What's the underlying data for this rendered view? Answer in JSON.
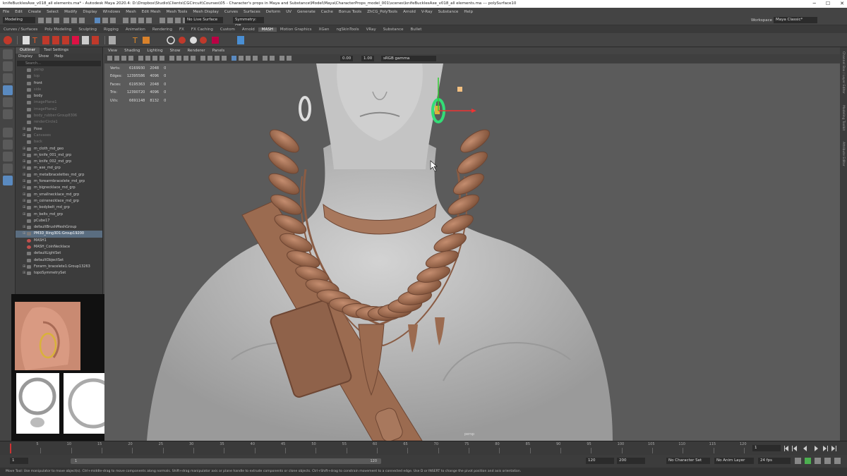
{
  "title_bar": {
    "text": "knifeBucklesAxe_v018_all elements.ma* - Autodesk Maya 2020.4: D:\\Dropbox\\Studio\\Clients\\CGCircuit\\Courses\\05 - Character's props in Maya and Substance\\Model\\Maya\\CharacterProps_model_001\\scenes\\knifeBucklesAxe_v018_all elements.ma  ---  polySurface10",
    "minimize": "─",
    "maximize": "☐",
    "close": "✕"
  },
  "menu_bar": [
    "File",
    "Edit",
    "Create",
    "Select",
    "Modify",
    "Display",
    "Windows",
    "Mesh",
    "Edit Mesh",
    "Mesh Tools",
    "Mesh Display",
    "Curves",
    "Surfaces",
    "Deform",
    "UV",
    "Generate",
    "Cache",
    "Bonus Tools",
    "ZhCG_PolyTools",
    "Arnold",
    "V-Ray",
    "Substance",
    "Help"
  ],
  "status_line": {
    "menu_set": "Modeling",
    "live_surface": "No Live Surface",
    "symmetry": "Symmetry: Off",
    "workspace_label": "Workspace :",
    "workspace_value": "Maya Classic*"
  },
  "shelf_tabs": [
    "Curves / Surfaces",
    "Poly Modeling",
    "Sculpting",
    "Rigging",
    "Animation",
    "Rendering",
    "FX",
    "FX Caching",
    "Custom",
    "Arnold",
    "MASH",
    "Motion Graphics",
    "XGen",
    "ngSkinTools",
    "VRay",
    "Substance",
    "Bullet"
  ],
  "shelf_active": "MASH",
  "outliner": {
    "tabs": [
      "Outliner",
      "Tool Settings"
    ],
    "menus": [
      "Display",
      "Show",
      "Help"
    ],
    "search_placeholder": "Search...",
    "items": [
      {
        "label": "persp",
        "dim": true,
        "exp": ""
      },
      {
        "label": "top",
        "dim": true,
        "exp": ""
      },
      {
        "label": "front",
        "dim": false,
        "exp": ""
      },
      {
        "label": "side",
        "dim": true,
        "exp": ""
      },
      {
        "label": "body",
        "dim": false,
        "exp": ""
      },
      {
        "label": "imagePlane1",
        "dim": true,
        "exp": ""
      },
      {
        "label": "imagePlane2",
        "dim": true,
        "exp": ""
      },
      {
        "label": "body_rubber:Group8306",
        "dim": true,
        "exp": ""
      },
      {
        "label": "renderCircle1",
        "dim": true,
        "exp": ""
      },
      {
        "label": "Pose",
        "dim": false,
        "exp": "⊞"
      },
      {
        "label": "Canvases",
        "dim": true,
        "exp": "⊞"
      },
      {
        "label": "back",
        "dim": true,
        "exp": ""
      },
      {
        "label": "m_cloth_md_geo",
        "dim": false,
        "exp": "⊞"
      },
      {
        "label": "m_knife_001_md_grp",
        "dim": false,
        "exp": "⊞"
      },
      {
        "label": "m_knife_002_md_grp",
        "dim": false,
        "exp": "⊞"
      },
      {
        "label": "m_axe_md_grp",
        "dim": false,
        "exp": "⊞"
      },
      {
        "label": "m_metalbracelettes_md_grp",
        "dim": false,
        "exp": "⊞"
      },
      {
        "label": "m_forearmbracelete_md_grp",
        "dim": false,
        "exp": "⊞"
      },
      {
        "label": "m_bignecklace_md_grp",
        "dim": false,
        "exp": "⊞"
      },
      {
        "label": "m_smallnecklace_md_grp",
        "dim": false,
        "exp": "⊞"
      },
      {
        "label": "m_coinsnecklace_md_grp",
        "dim": false,
        "exp": "⊞"
      },
      {
        "label": "m_bodybelt_md_grp",
        "dim": false,
        "exp": "⊞"
      },
      {
        "label": "m_belts_md_grp",
        "dim": false,
        "exp": "⊞"
      },
      {
        "label": "pCube17",
        "dim": false,
        "exp": ""
      },
      {
        "label": "defaultBrushMeshGroup",
        "dim": false,
        "exp": "⊞"
      },
      {
        "label": "PM3D_Ring3D1:Group19200",
        "dim": false,
        "exp": "⊞",
        "selected": true
      },
      {
        "label": "MASH1",
        "dim": false,
        "exp": "",
        "red": true
      },
      {
        "label": "MASH_CoinNecklace",
        "dim": false,
        "exp": "",
        "red": true
      },
      {
        "label": "defaultLightSet",
        "dim": false,
        "exp": ""
      },
      {
        "label": "defaultObjectSet",
        "dim": false,
        "exp": ""
      },
      {
        "label": "Forarm_bracelete1:Group13263",
        "dim": false,
        "exp": "⊞"
      },
      {
        "label": "topoSymmetrySet",
        "dim": false,
        "exp": "⊞"
      }
    ]
  },
  "viewport": {
    "menus": [
      "View",
      "Shading",
      "Lighting",
      "Show",
      "Renderer",
      "Panels"
    ],
    "exposure": "0.00",
    "gamma": "1.00",
    "color_space": "sRGB gamma",
    "camera_label": "persp",
    "hud": [
      {
        "label": "Verts:",
        "a": "6169930",
        "b": "2048",
        "c": "0"
      },
      {
        "label": "Edges:",
        "a": "12395586",
        "b": "4096",
        "c": "0"
      },
      {
        "label": "Faces:",
        "a": "6195363",
        "b": "2048",
        "c": "0"
      },
      {
        "label": "Tris:",
        "a": "12390720",
        "b": "4096",
        "c": "0"
      },
      {
        "label": "UVs:",
        "a": "6691148",
        "b": "8132",
        "c": "0"
      }
    ]
  },
  "right_strip_labels": [
    "Channel Box / Layer Editor",
    "Modeling Toolkit",
    "Attribute Editor"
  ],
  "timeline": {
    "current_frame": "1",
    "range_start": "1",
    "range_inner_start": "1",
    "range_inner_end": "120",
    "range_end_a": "120",
    "range_end_b": "200",
    "character_set": "No Character Set",
    "anim_layer": "No Anim Layer",
    "fps": "24 fps",
    "ticks": [
      "5",
      "10",
      "15",
      "20",
      "25",
      "30",
      "35",
      "40",
      "45",
      "50",
      "55",
      "60",
      "65",
      "70",
      "75",
      "80",
      "85",
      "90",
      "95",
      "100",
      "105",
      "110",
      "115",
      "120"
    ]
  },
  "help_line": "Move Tool: Use manipulator to move object(s). Ctrl+middle-drag to move components along normals. Shift+drag manipulator axis or plane handle to extrude components or clone objects. Ctrl+Shift+drag to constrain movement to a connected edge. Use D or INSERT to change the pivot position and axis orientation.",
  "colors": {
    "skin": "#c9c9c9",
    "leather": "#9b6b50",
    "viewport_bg": "#5b5b5b",
    "selection_green": "#33dd77",
    "ring_gold": "#d9b23a"
  }
}
